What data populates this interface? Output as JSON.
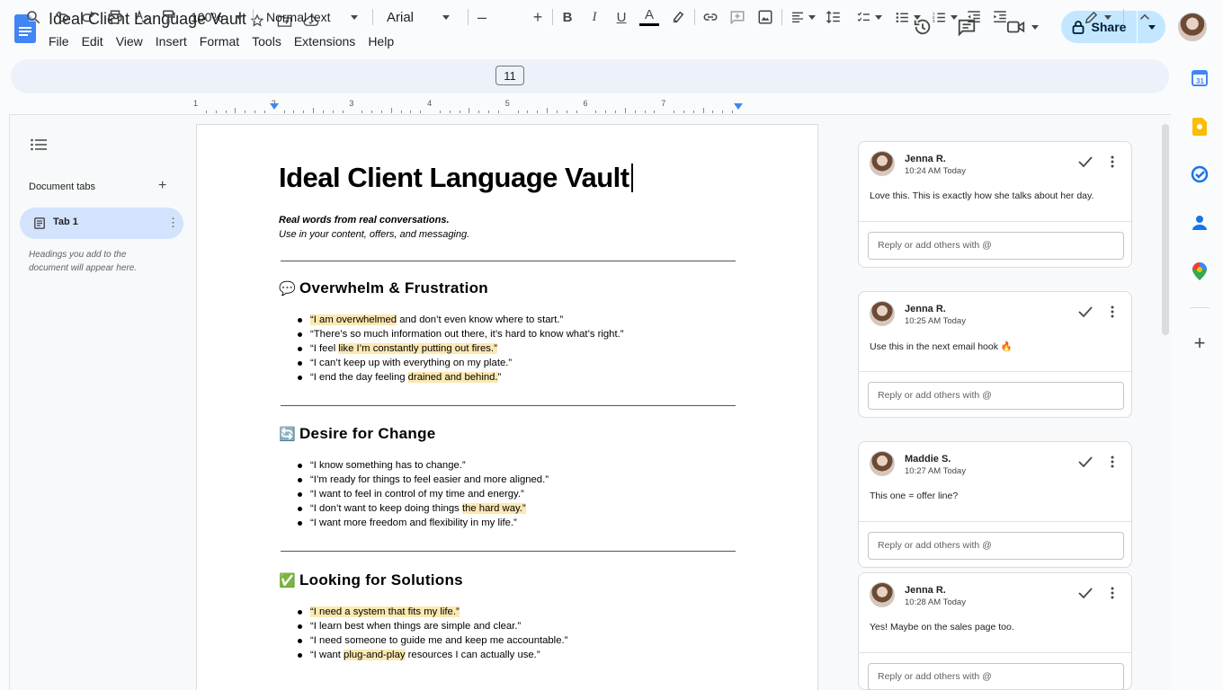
{
  "app": {
    "title": "Ideal Client Language Vault",
    "menu": [
      "File",
      "Edit",
      "View",
      "Insert",
      "Format",
      "Tools",
      "Extensions",
      "Help"
    ],
    "share_label": "Share"
  },
  "toolbar": {
    "zoom": "100%",
    "style": "Normal text",
    "font": "Arial",
    "font_size": "11"
  },
  "ruler": [
    "1",
    "1",
    "2",
    "3",
    "4",
    "5",
    "6",
    "7"
  ],
  "left_panel": {
    "tabs_label": "Document tabs",
    "tab1_label": "Tab 1",
    "hint": "Headings you add to the document will appear here."
  },
  "document": {
    "title": "Ideal Client Language Vault",
    "subtitle_line1": "Real words from real conversations.",
    "subtitle_line2": "Use in your content, offers, and messaging.",
    "sections": [
      {
        "emoji": "💬",
        "heading": "Overwhelm & Frustration",
        "items": [
          {
            "pre": "",
            "hl": "“I am overwhelmed",
            "post": " and don’t even know where to start.”"
          },
          {
            "pre": "“There’s so much information out there, it’s hard to know what’s right.”",
            "hl": "",
            "post": ""
          },
          {
            "pre": "“I feel ",
            "hl": "like I’m constantly putting out fires.”",
            "post": ""
          },
          {
            "pre": "“I can’t keep up with everything on my plate.”",
            "hl": "",
            "post": ""
          },
          {
            "pre": "“I end the day feeling ",
            "hl": "drained and behind.",
            "post": "”"
          }
        ]
      },
      {
        "emoji": "🔄",
        "heading": "Desire for Change",
        "items": [
          {
            "pre": "“I know something has to change.”",
            "hl": "",
            "post": ""
          },
          {
            "pre": "“I’m ready for things to feel easier and more aligned.”",
            "hl": "",
            "post": ""
          },
          {
            "pre": "“I want to feel in control of my time and energy.”",
            "hl": "",
            "post": ""
          },
          {
            "pre": "“I don’t want to keep doing things ",
            "hl": "the hard way.”",
            "post": ""
          },
          {
            "pre": "“I want more freedom and flexibility in my life.”",
            "hl": "",
            "post": ""
          }
        ]
      },
      {
        "emoji": "✅",
        "heading": "Looking for Solutions",
        "items": [
          {
            "pre": "",
            "hl": "“I need a system that fits my life.”",
            "post": ""
          },
          {
            "pre": "“I learn best when things are simple and clear.”",
            "hl": "",
            "post": ""
          },
          {
            "pre": "“I need someone to guide me and keep me accountable.”",
            "hl": "",
            "post": ""
          },
          {
            "pre": "“I want ",
            "hl": "plug-and-play",
            "post": " resources I can actually use.”"
          }
        ]
      }
    ]
  },
  "comments": [
    {
      "author": "Jenna R.",
      "time": "10:24 AM Today",
      "body": "Love this. This is exactly how she talks about her day.",
      "reply_placeholder": "Reply or add others with @"
    },
    {
      "author": "Jenna R.",
      "time": "10:25 AM Today",
      "body": "Use this in the next email hook 🔥",
      "reply_placeholder": "Reply or add others with @"
    },
    {
      "author": "Maddie S.",
      "time": "10:27 AM Today",
      "body": "This one = offer line?",
      "reply_placeholder": "Reply or add others with @"
    },
    {
      "author": "Jenna R.",
      "time": "10:28 AM Today",
      "body": "Yes! Maybe on the sales page too.",
      "reply_placeholder": "Reply or add others with @"
    }
  ],
  "colors": {
    "accent": "#0b57d0",
    "share_bg": "#c2e7ff",
    "highlight": "#fce8b2",
    "tab_bg": "#d3e3fd"
  }
}
